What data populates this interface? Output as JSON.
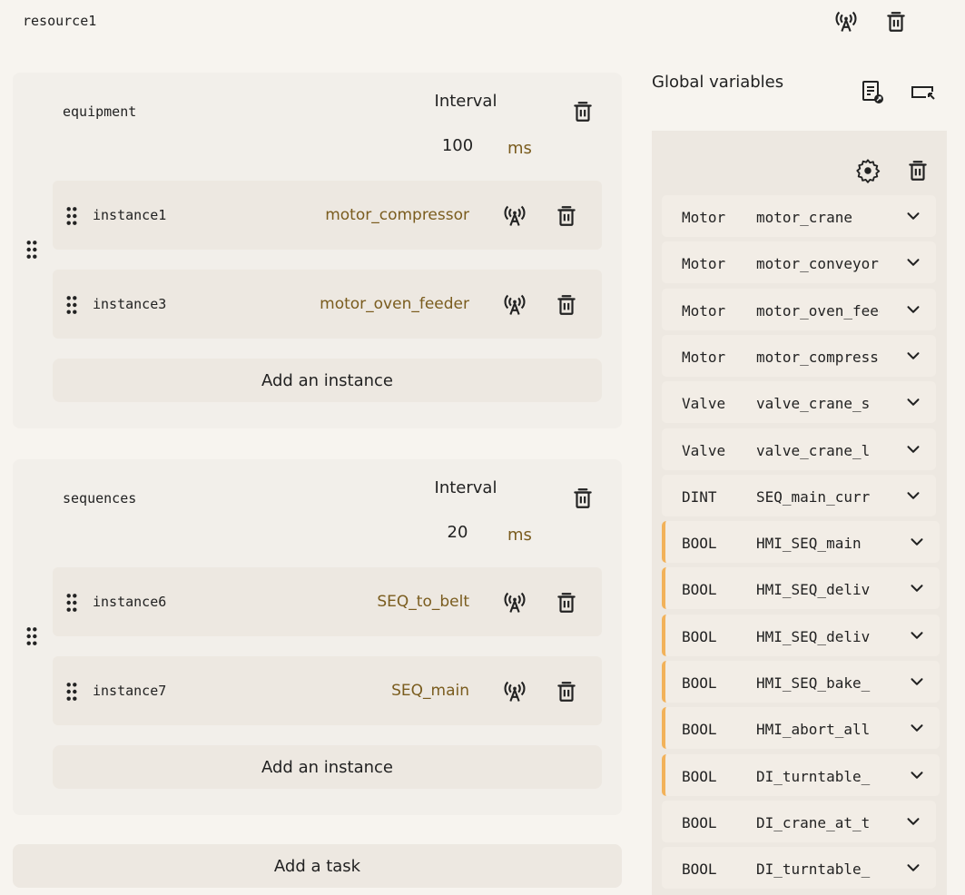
{
  "resource": {
    "title": "resource1"
  },
  "tasks": [
    {
      "name": "equipment",
      "interval_label": "Interval",
      "interval_value": "100",
      "interval_unit": "ms",
      "instances": [
        {
          "name": "instance1",
          "type": "motor_compressor"
        },
        {
          "name": "instance3",
          "type": "motor_oven_feeder"
        }
      ],
      "add_instance_label": "Add an instance"
    },
    {
      "name": "sequences",
      "interval_label": "Interval",
      "interval_value": "20",
      "interval_unit": "ms",
      "instances": [
        {
          "name": "instance6",
          "type": "SEQ_to_belt"
        },
        {
          "name": "instance7",
          "type": "SEQ_main"
        }
      ],
      "add_instance_label": "Add an instance"
    }
  ],
  "add_task_label": "Add a task",
  "global_variables": {
    "title": "Global variables",
    "rows": [
      {
        "type": "Motor",
        "name": "motor_crane",
        "flagged": false
      },
      {
        "type": "Motor",
        "name": "motor_conveyor",
        "flagged": false
      },
      {
        "type": "Motor",
        "name": "motor_oven_feeder",
        "flagged": false
      },
      {
        "type": "Motor",
        "name": "motor_compressor",
        "flagged": false
      },
      {
        "type": "Valve",
        "name": "valve_crane_s",
        "flagged": false
      },
      {
        "type": "Valve",
        "name": "valve_crane_l",
        "flagged": false
      },
      {
        "type": "DINT",
        "name": "SEQ_main_curr",
        "flagged": false
      },
      {
        "type": "BOOL",
        "name": "HMI_SEQ_main",
        "flagged": true
      },
      {
        "type": "BOOL",
        "name": "HMI_SEQ_deliv",
        "flagged": true
      },
      {
        "type": "BOOL",
        "name": "HMI_SEQ_deliv",
        "flagged": true
      },
      {
        "type": "BOOL",
        "name": "HMI_SEQ_bake_",
        "flagged": true
      },
      {
        "type": "BOOL",
        "name": "HMI_abort_all",
        "flagged": true
      },
      {
        "type": "BOOL",
        "name": "DI_turntable_",
        "flagged": true
      },
      {
        "type": "BOOL",
        "name": "DI_crane_at_t",
        "flagged": false
      },
      {
        "type": "BOOL",
        "name": "DI_turntable_",
        "flagged": false
      }
    ]
  },
  "colors": {
    "accent_text": "#7a5c1e",
    "flag": "#f2b25a",
    "background": "#f7f4ef"
  },
  "icons": [
    "antenna-icon",
    "trash-icon",
    "drag-handle-icon",
    "gear-icon",
    "chevron-down-icon",
    "document-link-icon",
    "collapse-panel-icon"
  ]
}
